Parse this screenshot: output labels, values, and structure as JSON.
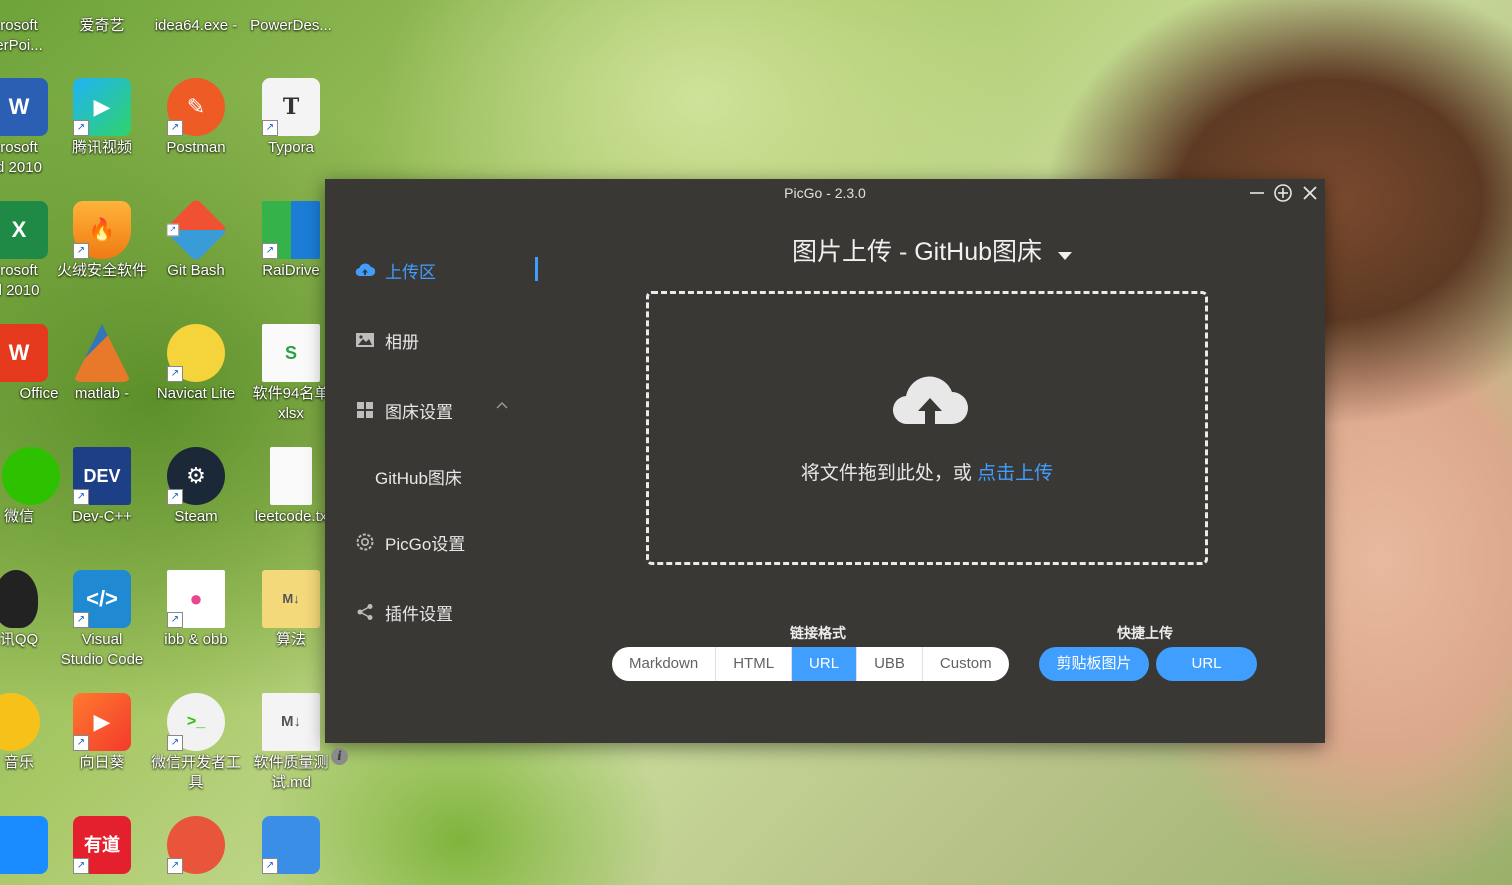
{
  "desktop": {
    "icons": [
      {
        "label": "rosoft\nerPoi..."
      },
      {
        "label": "爱奇艺"
      },
      {
        "label": "idea64.exe -"
      },
      {
        "label": "PowerDes..."
      },
      {
        "label": "rosoft\nd 2010"
      },
      {
        "label": "腾讯视频"
      },
      {
        "label": "Postman"
      },
      {
        "label": "Typora"
      },
      {
        "label": "rosoft\nl 2010"
      },
      {
        "label": "火绒安全软件"
      },
      {
        "label": "Git Bash"
      },
      {
        "label": "RaiDrive"
      },
      {
        "label": "Office"
      },
      {
        "label": "matlab -"
      },
      {
        "label": "Navicat Lite"
      },
      {
        "label": "软件94名单\nxlsx"
      },
      {
        "label": "微信"
      },
      {
        "label": "Dev-C++"
      },
      {
        "label": "Steam"
      },
      {
        "label": "leetcode.tx"
      },
      {
        "label": "讯QQ"
      },
      {
        "label": "Visual\nStudio Code"
      },
      {
        "label": "ibb & obb"
      },
      {
        "label": "算法"
      },
      {
        "label": "音乐"
      },
      {
        "label": "向日葵"
      },
      {
        "label": "微信开发者工\n具"
      },
      {
        "label": "软件质量测\n试.md"
      }
    ]
  },
  "window": {
    "title": "PicGo - 2.3.0",
    "controls": {
      "minimize": "—",
      "maximize": "⊕",
      "close": "✕"
    }
  },
  "sidebar": {
    "items": [
      {
        "label": "上传区",
        "icon": "cloud-upload-icon"
      },
      {
        "label": "相册",
        "icon": "picture-icon"
      },
      {
        "label": "图床设置",
        "icon": "grid-icon"
      },
      {
        "label": "GitHub图床"
      },
      {
        "label": "PicGo设置",
        "icon": "gear-icon"
      },
      {
        "label": "插件设置",
        "icon": "share-icon"
      }
    ],
    "info": "i"
  },
  "main": {
    "title": "图片上传 - GitHub图床",
    "drop_text": "将文件拖到此处，或",
    "drop_link": "点击上传",
    "link_format_label": "链接格式",
    "quick_upload_label": "快捷上传",
    "formats": [
      "Markdown",
      "HTML",
      "URL",
      "UBB",
      "Custom"
    ],
    "selected_format": "URL",
    "quick_buttons": [
      "剪贴板图片",
      "URL"
    ]
  },
  "colors": {
    "accent": "#409eff",
    "window_bg": "#3a3835"
  }
}
